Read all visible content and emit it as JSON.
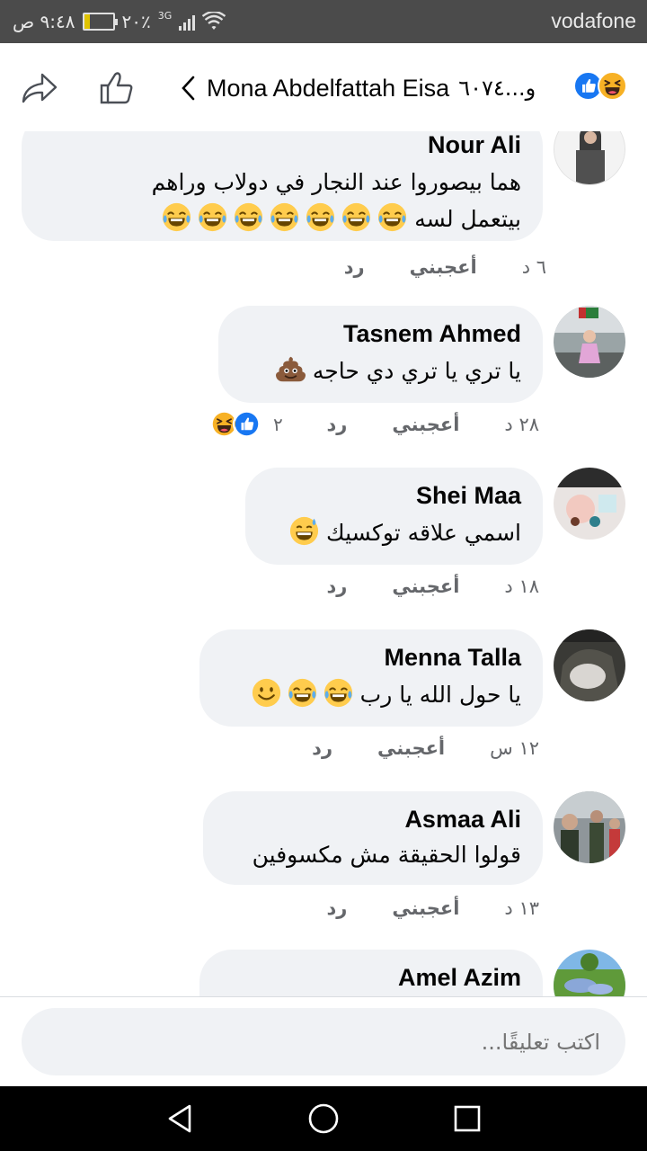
{
  "status_bar": {
    "carrier": "vodafone",
    "time": "٩:٤٨ ص",
    "battery": "٢٠٪",
    "battery_level": 0.2,
    "network": "3G"
  },
  "header": {
    "title": "Mona Abdelfattah Eisa",
    "reaction_count": "و...٦٠٧٤",
    "back_icon": "chevron-left-icon",
    "like_icon": "thumbs-up-icon",
    "share_icon": "share-arrow-icon"
  },
  "comments": [
    {
      "name": "Nour Ali",
      "text_line1": "هما بيصوروا عند النجار في دولاب وراهم",
      "text_line2": "بيتعمل لسه",
      "emojis": [
        "tears-of-joy",
        "tears-of-joy",
        "tears-of-joy",
        "tears-of-joy",
        "tears-of-joy",
        "tears-of-joy",
        "tears-of-joy"
      ],
      "time": "٦ د",
      "like_label": "أعجبني",
      "reply_label": "رد"
    },
    {
      "name": "Tasnem Ahmed",
      "text": "يا تري يا تري دي حاجه",
      "emojis": [
        "pile-of-poo"
      ],
      "time": "٢٨ د",
      "like_label": "أعجبني",
      "reply_label": "رد",
      "reaction_count": "٢"
    },
    {
      "name": "Shei Maa",
      "text": "اسمي علاقه توكسيك",
      "emojis": [
        "grinning-sweat"
      ],
      "time": "١٨ د",
      "like_label": "أعجبني",
      "reply_label": "رد"
    },
    {
      "name": "Menna Talla",
      "text": "يا حول الله يا رب",
      "emojis": [
        "tears-of-joy",
        "tears-of-joy",
        "smiling-face"
      ],
      "time": "١٢ س",
      "like_label": "أعجبني",
      "reply_label": "رد"
    },
    {
      "name": "Asmaa Ali",
      "text": "قولوا الحقيقة مش مكسوفين",
      "time": "١٣ د",
      "like_label": "أعجبني",
      "reply_label": "رد"
    },
    {
      "name": "Amel Azim"
    }
  ],
  "composer": {
    "placeholder": "اكتب تعليقًا..."
  },
  "navbar": {
    "back": "triangle-back-icon",
    "home": "circle-home-icon",
    "recents": "square-recents-icon"
  },
  "colors": {
    "like_blue": "#1877f2",
    "haha_yellow": "#f7b125",
    "bubble_bg": "#f0f2f5",
    "meta_gray": "#65676b"
  }
}
